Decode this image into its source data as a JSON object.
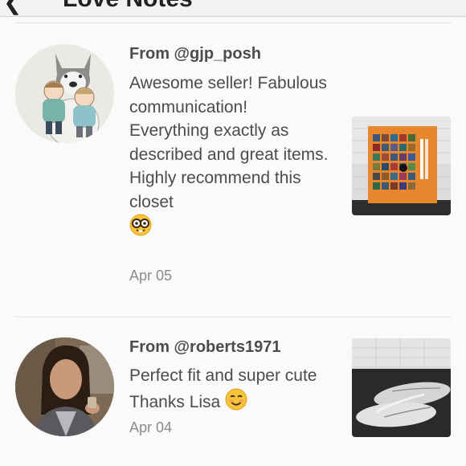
{
  "header": {
    "back_glyph": "❮",
    "title": "Love Notes"
  },
  "reviews": [
    {
      "from": "From @gjp_posh",
      "text": "Awesome seller! Fabulous communication! Everything exactly as described and great items. Highly recommend this closet",
      "emoji": "nerd-face-emoji",
      "date": "Apr 05",
      "avatar_icon": "husky-with-kids-avatar",
      "thumbnail": "tourist-icon-book-photo"
    },
    {
      "from": "From @roberts1971",
      "text": "Perfect fit and super cute Thanks Lisa",
      "emoji": "smiling-face-emoji",
      "date": "Apr 04",
      "avatar_icon": "woman-portrait-avatar",
      "thumbnail": "american-eagle-flip-flops-photo"
    }
  ],
  "colors": {
    "text": "#4e4b49",
    "date": "#8e8a87",
    "divider": "#e6e3e1",
    "background": "#fbfafa"
  }
}
